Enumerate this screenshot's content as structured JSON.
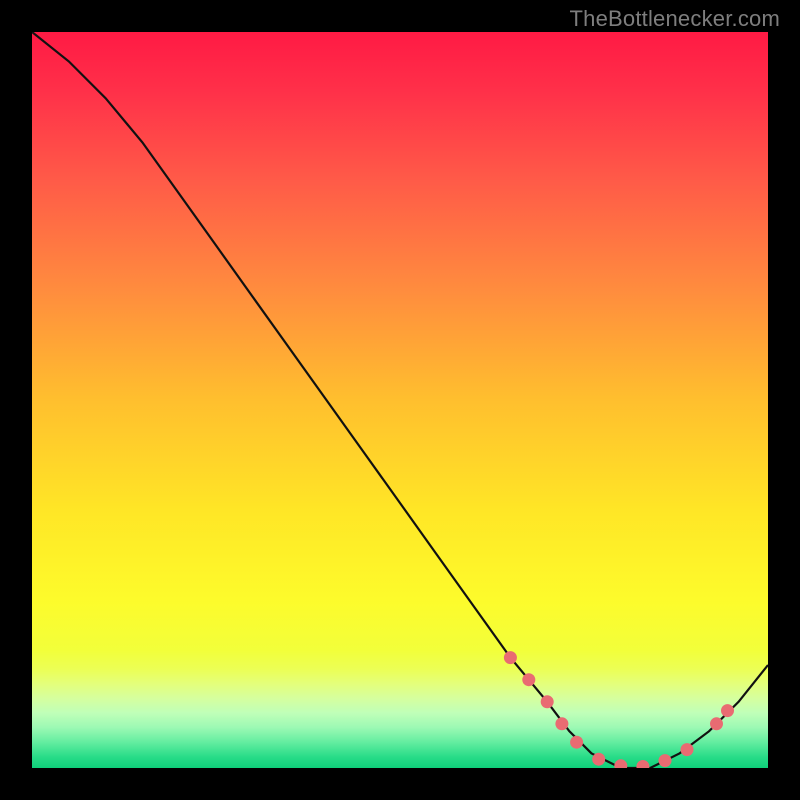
{
  "watermark": "TheBottlenecker.com",
  "chart_data": {
    "type": "line",
    "title": "",
    "xlabel": "",
    "ylabel": "",
    "xlim": [
      0,
      100
    ],
    "ylim": [
      0,
      100
    ],
    "grid": false,
    "legend": false,
    "series": [
      {
        "name": "curve",
        "x": [
          0,
          5,
          10,
          15,
          20,
          25,
          30,
          35,
          40,
          45,
          50,
          55,
          60,
          65,
          70,
          73,
          76,
          80,
          84,
          88,
          92,
          96,
          100
        ],
        "y": [
          100,
          96,
          91,
          85,
          78,
          71,
          64,
          57,
          50,
          43,
          36,
          29,
          22,
          15,
          9,
          5,
          2,
          0,
          0,
          2,
          5,
          9,
          14
        ]
      }
    ],
    "markers": [
      {
        "x": 65.0,
        "y": 15.0
      },
      {
        "x": 67.5,
        "y": 12.0
      },
      {
        "x": 70.0,
        "y": 9.0
      },
      {
        "x": 72.0,
        "y": 6.0
      },
      {
        "x": 74.0,
        "y": 3.5
      },
      {
        "x": 77.0,
        "y": 1.2
      },
      {
        "x": 80.0,
        "y": 0.3
      },
      {
        "x": 83.0,
        "y": 0.2
      },
      {
        "x": 86.0,
        "y": 1.0
      },
      {
        "x": 89.0,
        "y": 2.5
      },
      {
        "x": 93.0,
        "y": 6.0
      },
      {
        "x": 94.5,
        "y": 7.8
      }
    ],
    "gradient_stops": [
      {
        "offset": 0.0,
        "color": "#ff1a44"
      },
      {
        "offset": 0.08,
        "color": "#ff3049"
      },
      {
        "offset": 0.2,
        "color": "#ff5a48"
      },
      {
        "offset": 0.35,
        "color": "#ff8c3e"
      },
      {
        "offset": 0.5,
        "color": "#ffbf2e"
      },
      {
        "offset": 0.65,
        "color": "#ffe626"
      },
      {
        "offset": 0.77,
        "color": "#fdfb2b"
      },
      {
        "offset": 0.84,
        "color": "#f2ff3a"
      },
      {
        "offset": 0.865,
        "color": "#ecff54"
      },
      {
        "offset": 0.885,
        "color": "#e4ff7a"
      },
      {
        "offset": 0.905,
        "color": "#d6ff9e"
      },
      {
        "offset": 0.925,
        "color": "#c0ffb8"
      },
      {
        "offset": 0.945,
        "color": "#9cf9b4"
      },
      {
        "offset": 0.965,
        "color": "#63eda0"
      },
      {
        "offset": 0.985,
        "color": "#28dc88"
      },
      {
        "offset": 1.0,
        "color": "#0fd07a"
      }
    ],
    "marker_color": "#e96b72",
    "curve_color": "#111111"
  }
}
